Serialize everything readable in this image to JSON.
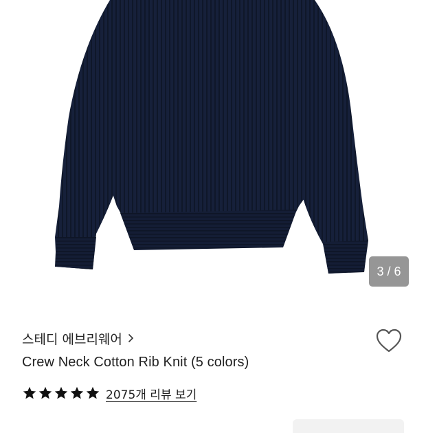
{
  "gallery": {
    "counter": "3 / 6",
    "sweater_color": "#16203a"
  },
  "product": {
    "brand": "스테디 에브리웨어",
    "title": "Crew Neck Cotton Rib Knit (5 colors)",
    "rating_stars": 5,
    "reviews_link": "2075개 리뷰 보기"
  },
  "icons": {
    "brand_chevron": "chevron-right-icon",
    "wishlist": "heart-outline-icon",
    "star": "star-icon"
  }
}
